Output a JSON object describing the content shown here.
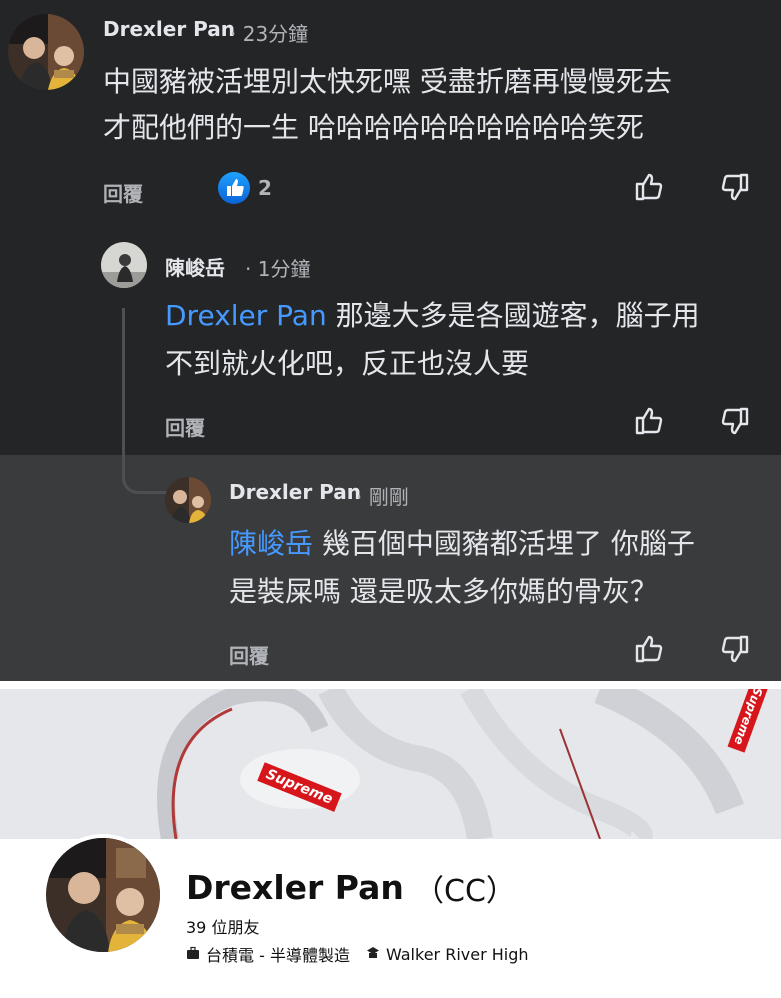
{
  "comments": [
    {
      "author": "Drexler Pan",
      "time": "· 23分鐘",
      "lines": [
        "中國豬被活埋別太快死嘿 受盡折磨再慢慢死去",
        "才配他們的一生 哈哈哈哈哈哈哈哈哈哈笑死"
      ],
      "reply_label": "回覆",
      "like_count": "2"
    },
    {
      "author": "陳峻岳",
      "time": "· 1分鐘",
      "mention": "Drexler Pan",
      "line1_rest": " 那邊大多是各國遊客，腦子用",
      "line2": "不到就火化吧，反正也沒人要",
      "reply_label": "回覆"
    },
    {
      "author": "Drexler Pan",
      "time": "· 剛剛",
      "mention": "陳峻岳",
      "line1_rest": " 幾百個中國豬都活埋了 你腦子",
      "line2": "是裝屎嗎 還是吸太多你媽的骨灰？",
      "reply_label": "回覆"
    }
  ],
  "cover": {
    "tag1": "Supreme",
    "tag2": "Supreme"
  },
  "profile": {
    "name": "Drexler Pan",
    "alt_name": "（CC）",
    "friends": "39 位朋友",
    "work": "台積電 - 半導體製造",
    "school": "Walker River High"
  },
  "colors": {
    "dark_bg": "#242526",
    "highlight_bg": "#3a3b3c",
    "mention": "#4599ff",
    "like_blue": "#1877f2"
  },
  "icons": [
    "thumbs-up-icon",
    "thumbs-down-icon",
    "like-reaction-icon",
    "briefcase-icon",
    "school-icon"
  ]
}
